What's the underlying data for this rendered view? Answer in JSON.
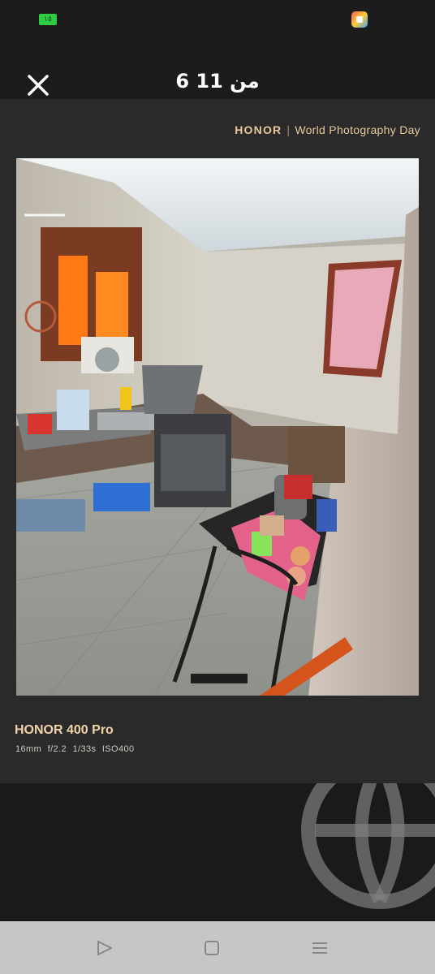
{
  "status_bar": {
    "battery_text": "١٥",
    "battery_color": "#2ecc40"
  },
  "header": {
    "counter": "6 من 11",
    "close_icon": "close-icon"
  },
  "watermark": {
    "brand": "HONOR",
    "separator": "|",
    "event": "World Photography Day"
  },
  "photo": {
    "subject": "kitchen photo"
  },
  "camera": {
    "model": "HONOR 400 Pro",
    "specs": "16mm f/2.2 1/33s ISO400"
  },
  "nav": {
    "back_icon": "back-triangle-icon",
    "home_icon": "home-square-icon",
    "recent_icon": "menu-lines-icon"
  },
  "colors": {
    "accent_gold": "#f2d3aa",
    "background": "#1c1c1c"
  }
}
